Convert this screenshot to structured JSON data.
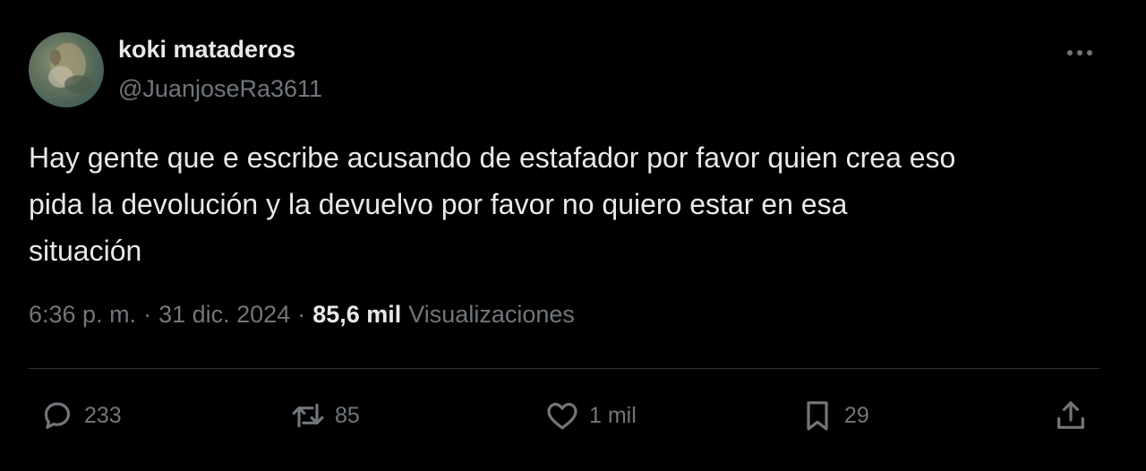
{
  "author": {
    "display_name": "koki mataderos",
    "handle": "@JuanjoseRa3611"
  },
  "tweet": {
    "text": "Hay gente que e escribe acusando de estafador por favor quien crea eso\npida la devolución y la devuelvo por favor no quiero estar en esa\nsituación",
    "time": "6:36 p. m.",
    "separator": "·",
    "date": "31 dic. 2024",
    "views_count": "85,6 mil",
    "views_label": "Visualizaciones"
  },
  "actions": {
    "replies": "233",
    "reposts": "85",
    "likes": "1 mil",
    "bookmarks": "29"
  },
  "icons": {
    "more": "more-dots-icon",
    "reply": "reply-bubble-icon",
    "repost": "repost-arrows-icon",
    "like": "heart-icon",
    "bookmark": "bookmark-icon",
    "share": "share-upload-icon"
  },
  "colors": {
    "background": "#000000",
    "text_primary": "#e7e9ea",
    "text_secondary": "#71767b",
    "divider": "#2f3336"
  }
}
